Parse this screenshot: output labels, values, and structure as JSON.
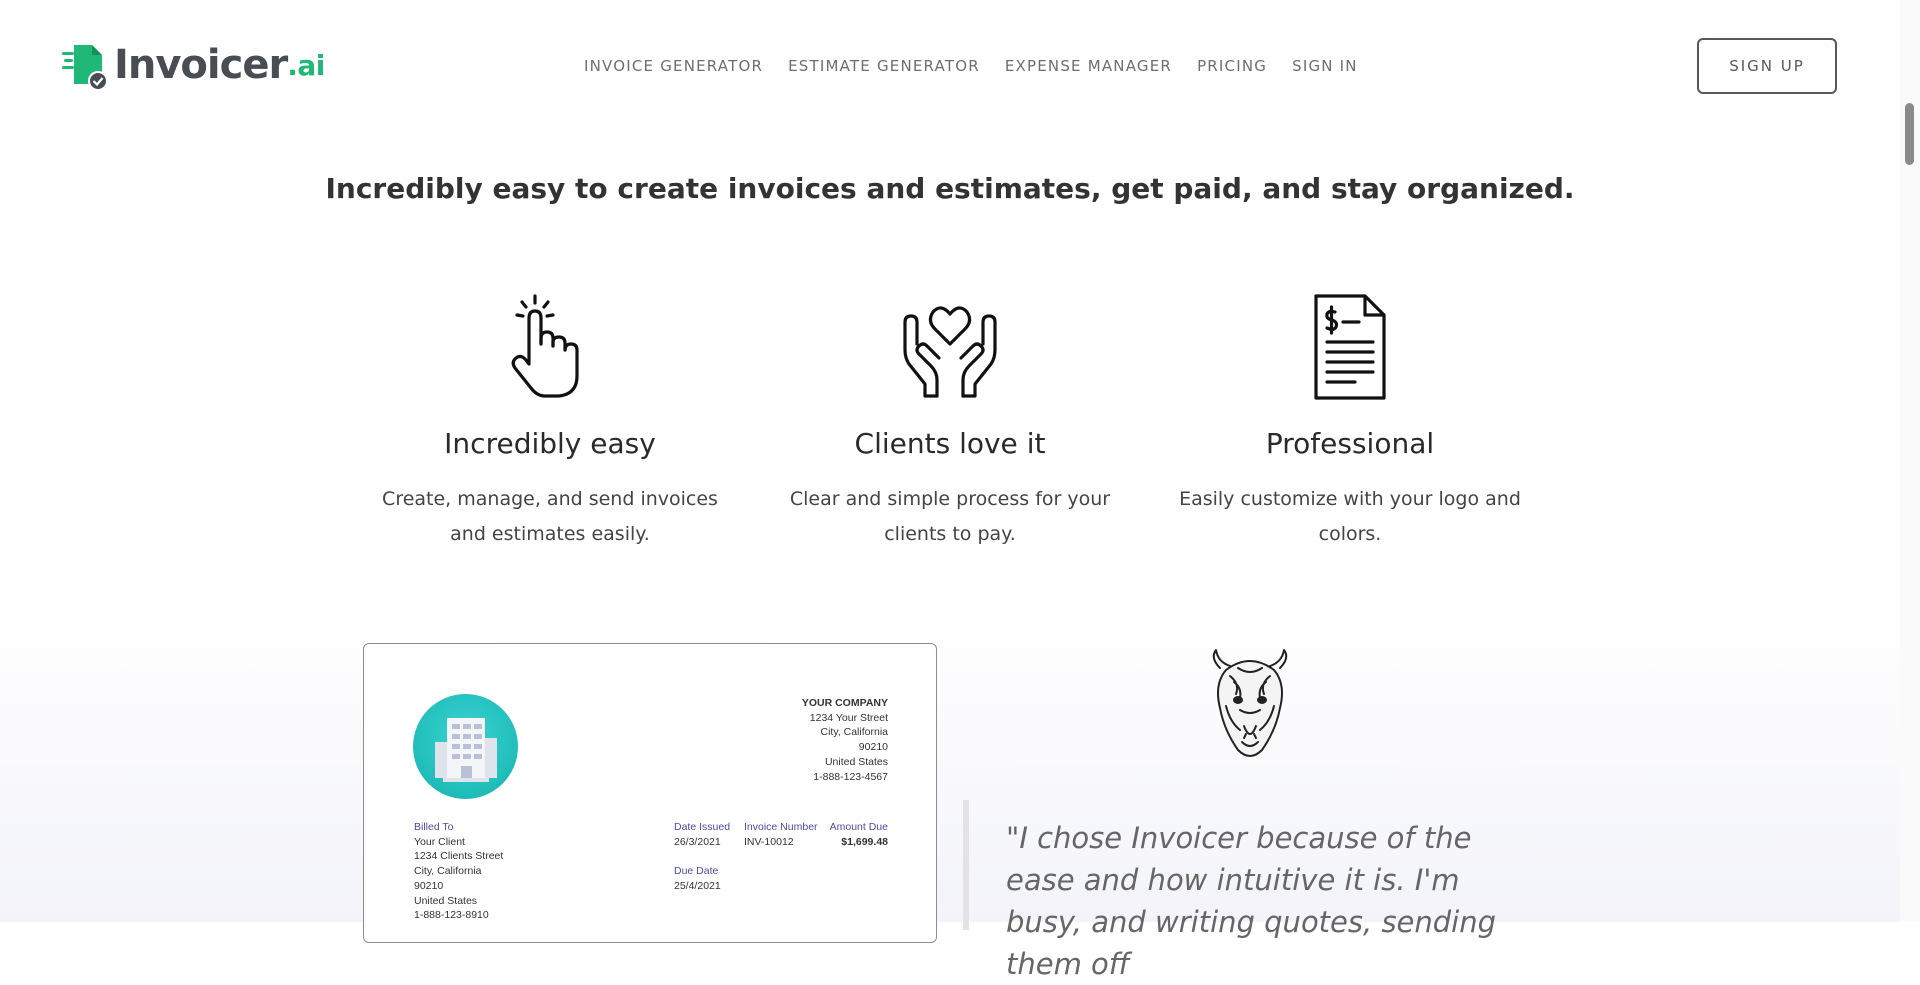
{
  "header": {
    "logo": {
      "name": "Invoicer",
      "suffix": ".ai"
    },
    "nav": [
      "INVOICE GENERATOR",
      "ESTIMATE GENERATOR",
      "EXPENSE MANAGER",
      "PRICING",
      "SIGN IN"
    ],
    "signup_label": "SIGN UP"
  },
  "tagline": "Incredibly easy to create invoices and estimates, get paid, and stay organized.",
  "features": [
    {
      "icon": "tap-hand-icon",
      "title": "Incredibly easy",
      "text": "Create, manage, and send invoices and estimates easily."
    },
    {
      "icon": "heart-hands-icon",
      "title": "Clients love it",
      "text": "Clear and simple process for your clients to pay."
    },
    {
      "icon": "invoice-document-icon",
      "title": "Professional",
      "text": "Easily customize with your logo and colors."
    }
  ],
  "invoice": {
    "company": [
      "YOUR COMPANY",
      "1234 Your Street",
      "City, California",
      "90210",
      "United States",
      "1-888-123-4567"
    ],
    "billed_to_label": "Billed To",
    "billed_to": [
      "Your Client",
      "1234 Clients Street",
      "City, California",
      "90210",
      "United States",
      "1-888-123-8910"
    ],
    "date_issued_label": "Date Issued",
    "date_issued": "26/3/2021",
    "invoice_number_label": "Invoice Number",
    "invoice_number": "INV-10012",
    "amount_due_label": "Amount Due",
    "amount_due": "$1,699.48",
    "due_date_label": "Due Date",
    "due_date": "25/4/2021"
  },
  "testimonial": {
    "quote": "\"I chose Invoicer because of the ease and how intuitive it is. I'm busy, and writing quotes, sending them off"
  },
  "colors": {
    "brand_green": "#1fb877",
    "logo_gray": "#474d52",
    "invoice_teal": "#14b3ae",
    "invoice_label": "#4b4ea0"
  }
}
